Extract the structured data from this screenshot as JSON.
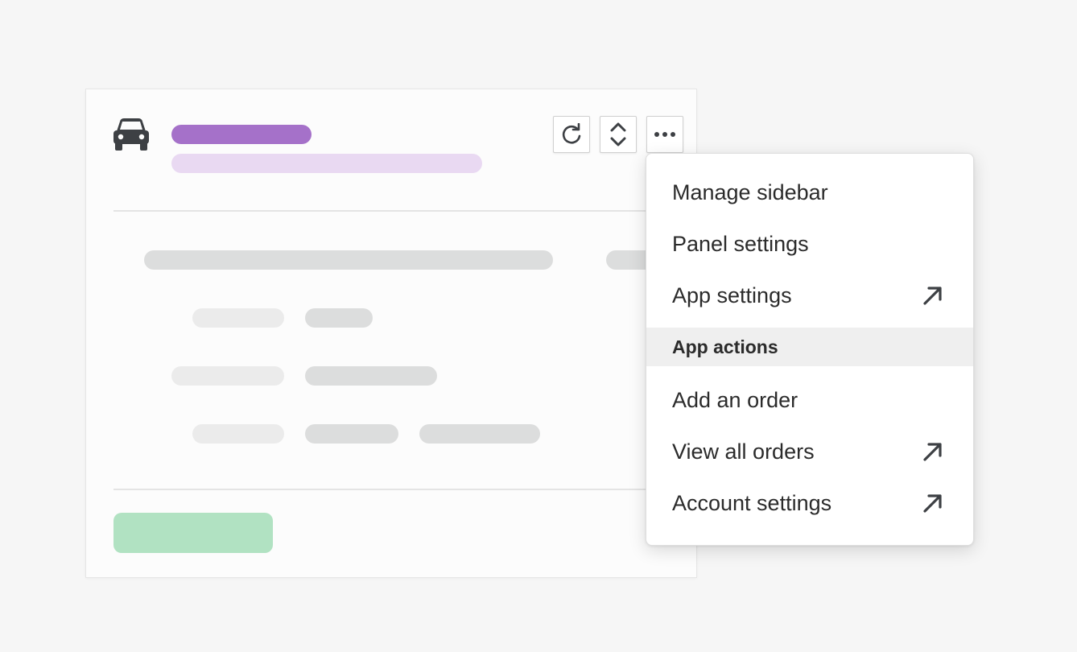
{
  "colors": {
    "background": "#f6f6f6",
    "title_accent": "#a571c9",
    "subtitle_accent": "#e9d9f2",
    "primary_button": "#b1e2c2",
    "icon": "#3d4044"
  },
  "panel": {
    "icon": "car-icon",
    "toolbar": [
      {
        "name": "refresh-button",
        "icon": "refresh-icon"
      },
      {
        "name": "expand-button",
        "icon": "chevron-up-down-icon"
      },
      {
        "name": "more-button",
        "icon": "ellipsis-icon"
      }
    ]
  },
  "menu": {
    "items": [
      {
        "label": "Manage sidebar",
        "external": false
      },
      {
        "label": "Panel settings",
        "external": false
      },
      {
        "label": "App settings",
        "external": true
      }
    ],
    "section_header": "App actions",
    "actions": [
      {
        "label": "Add an order",
        "external": false
      },
      {
        "label": "View all orders",
        "external": true
      },
      {
        "label": "Account settings",
        "external": true
      }
    ],
    "external_icon": "arrow-up-right-icon"
  }
}
